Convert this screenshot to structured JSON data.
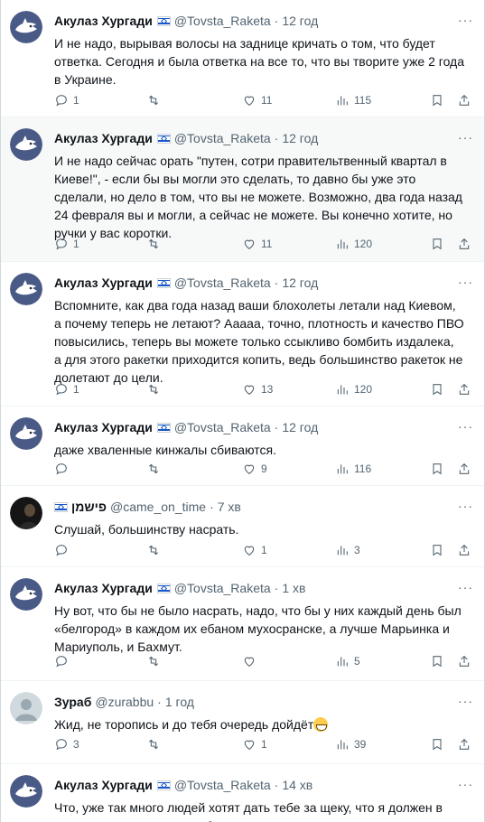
{
  "tweets": [
    {
      "name": "Акулаз Хургади",
      "flag": true,
      "handle": "@Tovsta_Raketa",
      "time": "12 год",
      "avatar": "shark",
      "text": "И не надо, вырывая волосы на заднице кричать о том, что будет ответка. Сегодня и была ответка на все то, что вы творите уже 2 года в Украине.",
      "reply": "1",
      "retweet": "",
      "like": "11",
      "views": "115"
    },
    {
      "name": "Акулаз Хургади",
      "flag": true,
      "handle": "@Tovsta_Raketa",
      "time": "12 год",
      "avatar": "shark",
      "text": "И не надо сейчас орать \"путен, сотри правительтвенный квартал в Киеве!\", - если бы вы могли это сделать, то давно бы уже это сделали, но дело в том, что вы не можете. Возможно, два года назад 24 февраля вы и могли, а сейчас не можете. Вы конечно хотите, но ручки у вас коротки.",
      "reply": "1",
      "retweet": "",
      "like": "11",
      "views": "120"
    },
    {
      "name": "Акулаз Хургади",
      "flag": true,
      "handle": "@Tovsta_Raketa",
      "time": "12 год",
      "avatar": "shark",
      "text": "Вспомните, как два года назад ваши блохолеты летали над Киевом, а почему теперь не летают? Ааааа, точно, плотность и качество ПВО повысились, теперь вы можете только ссыкливо бомбить издалека, а для этого ракетки приходится копить, ведь большинство ракеток не долетают до цели.",
      "reply": "1",
      "retweet": "",
      "like": "13",
      "views": "120"
    },
    {
      "name": "Акулаз Хургади",
      "flag": true,
      "handle": "@Tovsta_Raketa",
      "time": "12 год",
      "avatar": "shark",
      "text": "даже хваленные кинжалы сбиваются.",
      "reply": "",
      "retweet": "",
      "like": "9",
      "views": "116"
    },
    {
      "name": "פישמן",
      "flag": true,
      "flag_before": true,
      "handle": "@came_on_time",
      "time": "7 хв",
      "avatar": "dark",
      "text": "Слушай, большинству насрать.",
      "reply": "",
      "retweet": "",
      "like": "1",
      "views": "3"
    },
    {
      "name": "Акулаз Хургади",
      "flag": true,
      "handle": "@Tovsta_Raketa",
      "time": "1 хв",
      "avatar": "shark",
      "text": "Ну вот, что бы не было насрать, надо, что бы у них каждый день был «белгород» в каждом их ебаном мухосранске, а лучше Марьинка и Мариуполь, и Бахмут.",
      "reply": "",
      "retweet": "",
      "like": "",
      "views": "5"
    },
    {
      "name": "Зураб",
      "flag": false,
      "handle": "@zurabbu",
      "time": "1 год",
      "avatar": "grey",
      "text": "Жид, не торопись и до тебя очередь дойдёт",
      "emoji": "grin-emoji",
      "reply": "3",
      "retweet": "",
      "like": "1",
      "views": "39"
    },
    {
      "name": "Акулаз Хургади",
      "flag": true,
      "handle": "@Tovsta_Raketa",
      "time": "14 хв",
      "avatar": "shark",
      "text": "Что, уже так много людей хотят дать тебе за щеку, что я должен в очереди за ними отстоять?",
      "reply": "",
      "retweet": "",
      "like": "",
      "views": ""
    }
  ],
  "icons": {
    "more": "more-icon",
    "reply": "reply-icon",
    "retweet": "retweet-icon",
    "like": "like-icon",
    "views": "views-icon",
    "bookmark": "bookmark-icon",
    "share": "share-icon"
  },
  "colors": {
    "text": "#0f1419",
    "secondary": "#536471",
    "highlight_bg": "#f7f9f9",
    "divider": "#eff3f4",
    "avatar_shark": "#4a5a86"
  }
}
